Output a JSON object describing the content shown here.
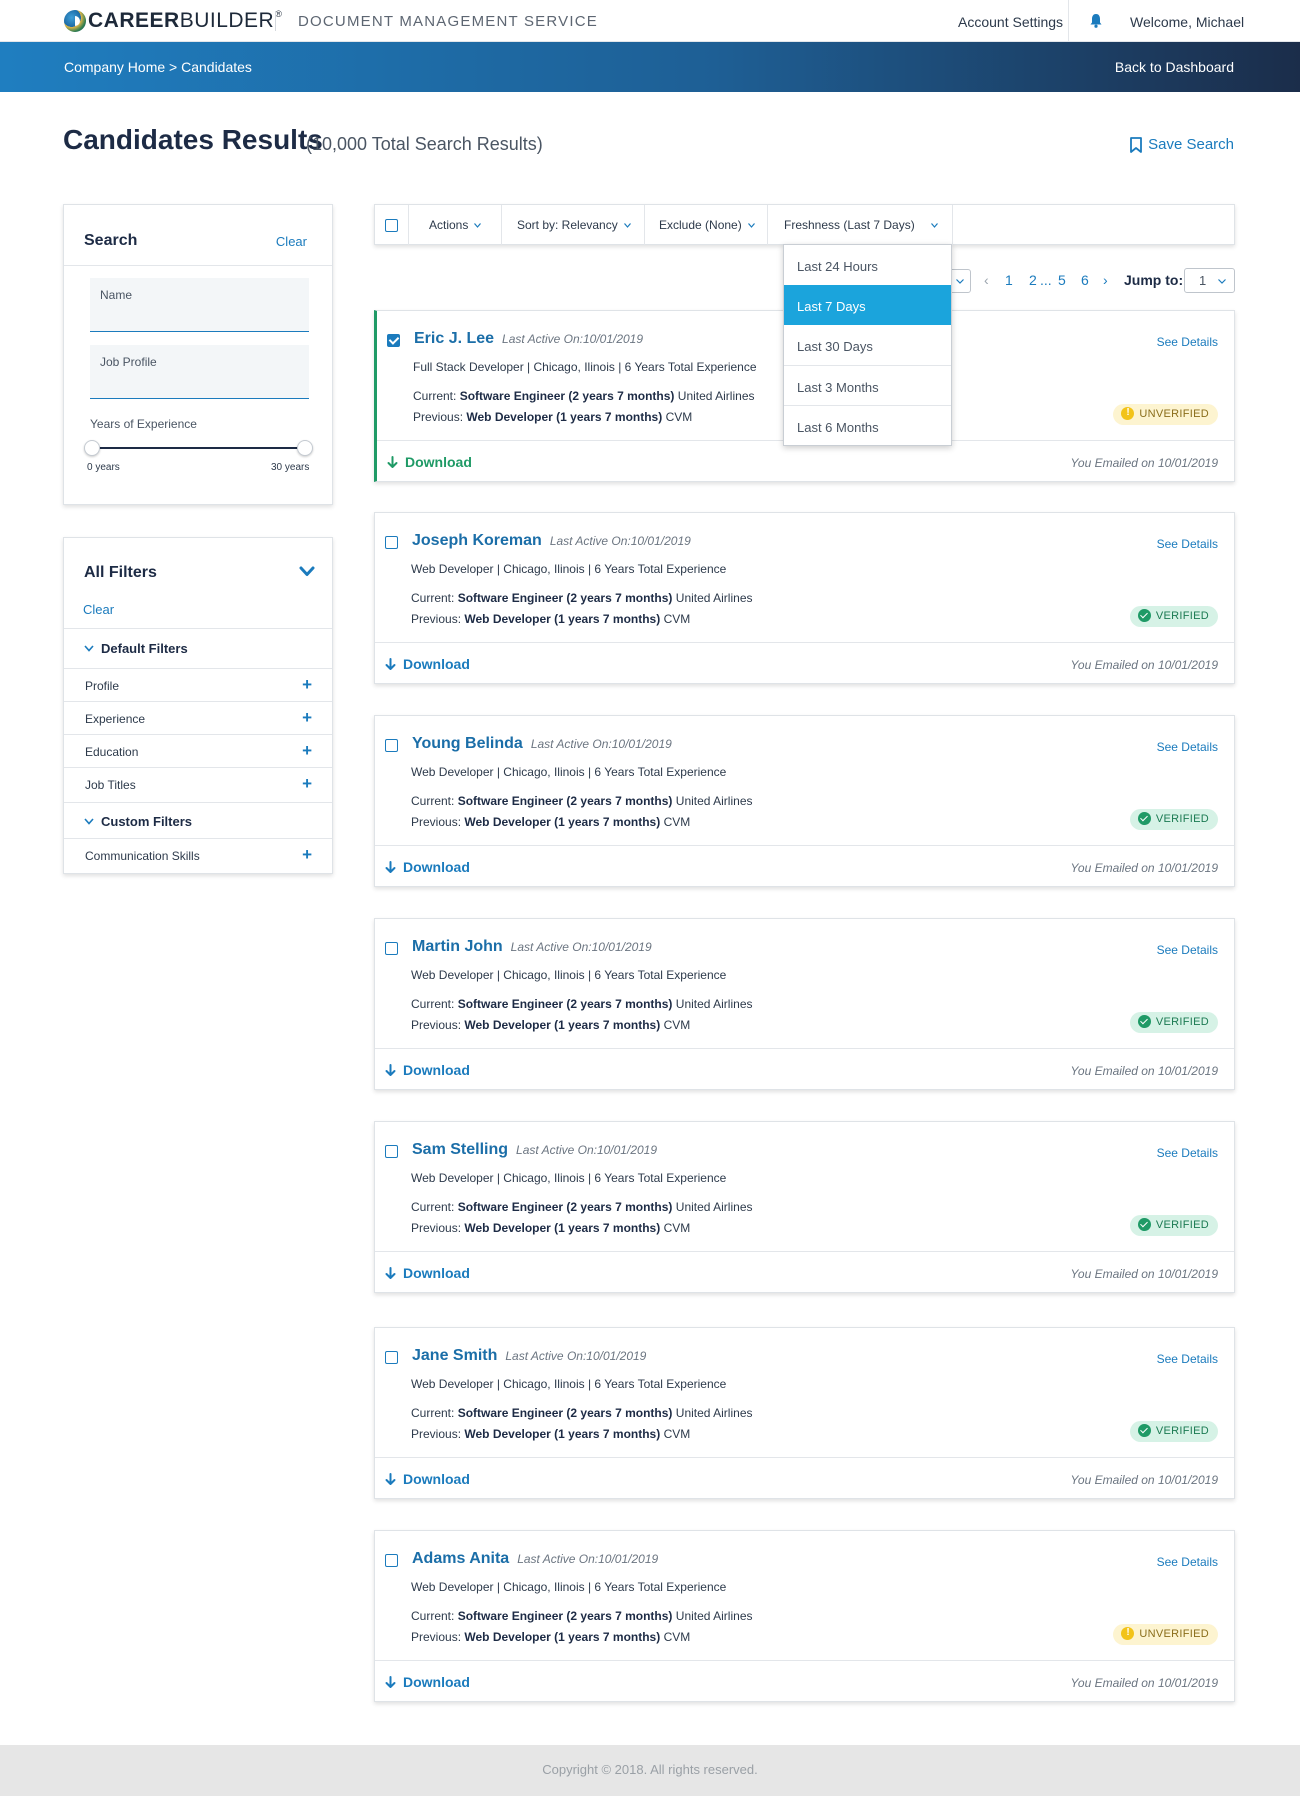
{
  "header": {
    "logo_bold": "CAREER",
    "logo_light": "BUILDER",
    "logo_mark": "®",
    "app_title": "DOCUMENT MANAGEMENT SERVICE",
    "account_settings": "Account Settings",
    "welcome": "Welcome, Michael"
  },
  "band": {
    "breadcrumb": "Company Home > Candidates",
    "back_label": "Back to Dashboard"
  },
  "page": {
    "title": "Candidates Results",
    "subtitle": "(10,000 Total Search Results)",
    "save_search": "Save Search"
  },
  "search": {
    "title": "Search",
    "clear": "Clear",
    "name_label": "Name",
    "name_value": "",
    "job_label": "Job Profile",
    "job_value": "",
    "yoe_label": "Years of Experience",
    "yoe_min": "0 years",
    "yoe_max": "30 years"
  },
  "filters": {
    "title": "All Filters",
    "clear": "Clear",
    "default_group": "Default Filters",
    "default_items": [
      "Profile",
      "Experience",
      "Education",
      "Job Titles"
    ],
    "custom_group": "Custom Filters",
    "custom_items": [
      "Communication Skills"
    ]
  },
  "toolbar": {
    "actions": "Actions",
    "sort": "Sort by: Relevancy",
    "exclude": "Exclude (None)",
    "freshness": "Freshness (Last 7 Days)"
  },
  "freshness_options": {
    "items": [
      "Last 24 Hours",
      "Last 7 Days",
      "Last 30 Days",
      "Last 3 Months",
      "Last 6 Months"
    ],
    "selected": "Last 7 Days"
  },
  "pagination": {
    "pages": [
      "1",
      "2",
      "...",
      "5",
      "6"
    ],
    "jump_label": "Jump to:",
    "jump_value": "1"
  },
  "candidates": [
    {
      "name": "Eric J. Lee",
      "last_active": "Last Active On:10/01/2019",
      "meta": "Full Stack Developer  |  Chicago,  Ilinois  |  6 Years Total Experience",
      "current_label": "Current:",
      "current_role": "Software Engineer (2 years 7 months)",
      "current_company": "United Airlines",
      "previous_label": "Previous:",
      "previous_role": "Web Developer (1 years 7 months)",
      "previous_company": "CVM",
      "status": "UNVERIFIED",
      "details": "See Details",
      "download": "Download",
      "emailed": "You Emailed on 10/01/2019",
      "checked": true
    },
    {
      "name": "Joseph Koreman",
      "last_active": "Last Active On:10/01/2019",
      "meta": "Web Developer  |  Chicago,  Ilinois  |  6 Years Total Experience",
      "current_label": "Current:",
      "current_role": "Software Engineer (2 years 7 months)",
      "current_company": "United Airlines",
      "previous_label": "Previous:",
      "previous_role": "Web Developer (1 years 7 months)",
      "previous_company": "CVM",
      "status": "VERIFIED",
      "details": "See Details",
      "download": "Download",
      "emailed": "You Emailed on 10/01/2019",
      "checked": false
    },
    {
      "name": "Young Belinda",
      "last_active": "Last Active On:10/01/2019",
      "meta": "Web Developer  |  Chicago,  Ilinois  |  6 Years Total Experience",
      "current_label": "Current:",
      "current_role": "Software Engineer (2 years 7 months)",
      "current_company": "United Airlines",
      "previous_label": "Previous:",
      "previous_role": "Web Developer (1 years 7 months)",
      "previous_company": "CVM",
      "status": "VERIFIED",
      "details": "See Details",
      "download": "Download",
      "emailed": "You Emailed on 10/01/2019",
      "checked": false
    },
    {
      "name": "Martin John",
      "last_active": "Last Active On:10/01/2019",
      "meta": "Web Developer  |  Chicago,  Ilinois  |  6 Years Total Experience",
      "current_label": "Current:",
      "current_role": "Software Engineer (2 years 7 months)",
      "current_company": "United Airlines",
      "previous_label": "Previous:",
      "previous_role": "Web Developer (1 years 7 months)",
      "previous_company": "CVM",
      "status": "VERIFIED",
      "details": "See Details",
      "download": "Download",
      "emailed": "You Emailed on 10/01/2019",
      "checked": false
    },
    {
      "name": "Sam Stelling",
      "last_active": "Last Active On:10/01/2019",
      "meta": "Web Developer  |  Chicago,  Ilinois  |  6 Years Total Experience",
      "current_label": "Current:",
      "current_role": "Software Engineer (2 years 7 months)",
      "current_company": "United Airlines",
      "previous_label": "Previous:",
      "previous_role": "Web Developer (1 years 7 months)",
      "previous_company": "CVM",
      "status": "VERIFIED",
      "details": "See Details",
      "download": "Download",
      "emailed": "You Emailed on 10/01/2019",
      "checked": false
    },
    {
      "name": "Jane Smith",
      "last_active": "Last Active On:10/01/2019",
      "meta": "Web Developer  |  Chicago,  Ilinois  |  6 Years Total Experience",
      "current_label": "Current:",
      "current_role": "Software Engineer (2 years 7 months)",
      "current_company": "United Airlines",
      "previous_label": "Previous:",
      "previous_role": "Web Developer (1 years 7 months)",
      "previous_company": "CVM",
      "status": "VERIFIED",
      "details": "See Details",
      "download": "Download",
      "emailed": "You Emailed on 10/01/2019",
      "checked": false
    },
    {
      "name": "Adams Anita",
      "last_active": "Last Active On:10/01/2019",
      "meta": "Web Developer  |  Chicago,  Ilinois  |  6 Years Total Experience",
      "current_label": "Current:",
      "current_role": "Software Engineer (2 years 7 months)",
      "current_company": "United Airlines",
      "previous_label": "Previous:",
      "previous_role": "Web Developer (1 years 7 months)",
      "previous_company": "CVM",
      "status": "UNVERIFIED",
      "details": "See Details",
      "download": "Download",
      "emailed": "You Emailed on 10/01/2019",
      "checked": false
    }
  ],
  "footer": {
    "copyright": "Copyright © 2018. All rights reserved."
  },
  "colors": {
    "accent": "#1b7bbd",
    "verified": "#1f9a66",
    "unverified": "#f2c319",
    "dropdown_selected": "#1ba4dc"
  }
}
